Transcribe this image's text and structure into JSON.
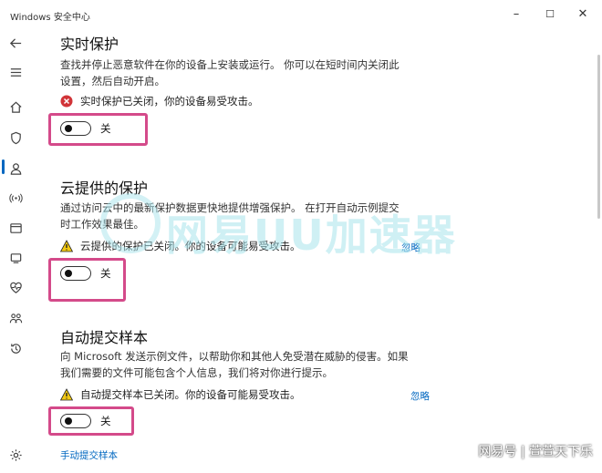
{
  "window": {
    "title": "Windows 安全中心",
    "minimize": "–",
    "maximize": "☐",
    "close": "✕"
  },
  "sections": {
    "realtime": {
      "heading": "实时保护",
      "desc_line1": "查找并停止恶意软件在你的设备上安装或运行。 你可以在短时间内关闭此",
      "desc_line2": "设置，然后自动开启。",
      "status": "实时保护已关闭，你的设备易受攻击。",
      "toggle_label": "关"
    },
    "cloud": {
      "heading": "云提供的保护",
      "desc_line1": "通过访问云中的最新保护数据更快地提供增强保护。 在打开自动示例提交",
      "desc_line2": "时工作效果最佳。",
      "status": "云提供的保护已关闭。你的设备可能易受攻击。",
      "ignore": "忽略",
      "toggle_label": "关"
    },
    "sample": {
      "heading": "自动提交样本",
      "desc_line1": "向 Microsoft 发送示例文件，以帮助你和其他人免受潜在威胁的侵害。如果",
      "desc_line2": "我们需要的文件可能包含个人信息，我们将对你进行提示。",
      "status": "自动提交样本已关闭。你的设备可能易受攻击。",
      "ignore": "忽略",
      "toggle_label": "关",
      "manual_link": "手动提交样本"
    }
  },
  "overlay": {
    "watermark": "网易UU加速器",
    "credit": "网易号 | 萱萱天下乐"
  },
  "colors": {
    "accent": "#0067c0",
    "highlight": "#d44a8a",
    "error": "#d13438",
    "warning": "#f2c811"
  }
}
